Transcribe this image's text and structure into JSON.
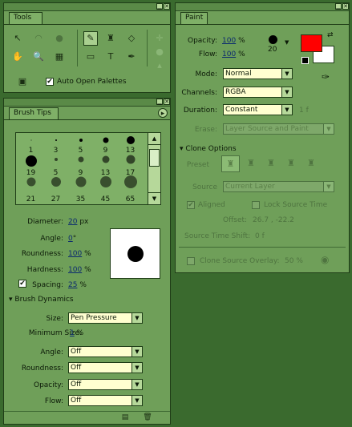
{
  "tools_panel": {
    "tab_label": "Tools",
    "auto_open_palettes_label": "Auto Open Palettes",
    "auto_open_palettes_checked": true
  },
  "brush_panel": {
    "tab_label": "Brush Tips",
    "tips_row1": [
      "1",
      "3",
      "5",
      "9",
      "13"
    ],
    "tips_row2": [
      "19",
      "5",
      "9",
      "13",
      "17"
    ],
    "tips_row3": [
      "21",
      "27",
      "35",
      "45",
      "65"
    ],
    "diameter": {
      "label": "Diameter:",
      "value": "20",
      "unit": "px"
    },
    "angle": {
      "label": "Angle:",
      "value": "0",
      "unit": "°"
    },
    "roundness": {
      "label": "Roundness:",
      "value": "100",
      "unit": "%"
    },
    "hardness": {
      "label": "Hardness:",
      "value": "100",
      "unit": "%"
    },
    "spacing": {
      "label": "Spacing:",
      "value": "25",
      "unit": "%",
      "checked": true
    },
    "dynamics": {
      "label": "Brush Dynamics",
      "size_label": "Size:",
      "size_value": "Pen Pressure",
      "min_size_label": "Minimum Size:",
      "min_size_value": "1",
      "min_size_unit": "%",
      "angle_label": "Angle:",
      "angle_value": "Off",
      "roundness_label": "Roundness:",
      "roundness_value": "Off",
      "opacity_label": "Opacity:",
      "opacity_value": "Off",
      "flow_label": "Flow:",
      "flow_value": "Off"
    }
  },
  "paint_panel": {
    "tab_label": "Paint",
    "opacity": {
      "label": "Opacity:",
      "value": "100",
      "unit": "%"
    },
    "flow": {
      "label": "Flow:",
      "value": "100",
      "unit": "%"
    },
    "brush_size_preview": "20",
    "foreground_color": "#ff0000",
    "background_color": "#ffffff",
    "mode": {
      "label": "Mode:",
      "value": "Normal"
    },
    "channels": {
      "label": "Channels:",
      "value": "RGBA"
    },
    "duration": {
      "label": "Duration:",
      "value": "Constant",
      "suffix": "1 f"
    },
    "erase": {
      "label": "Erase:",
      "value": "Layer Source and Paint"
    },
    "clone_options": {
      "label": "Clone Options",
      "preset_label": "Preset",
      "source_label": "Source",
      "source_value": "Current Layer",
      "aligned_label": "Aligned",
      "aligned_checked": true,
      "lock_source_time_label": "Lock Source Time",
      "lock_source_time_checked": false,
      "offset_label": "Offset:",
      "offset_value": "26.7 , -22.2",
      "source_time_shift_label": "Source Time Shift:",
      "source_time_shift_value": "0 f",
      "clone_source_overlay_label": "Clone Source Overlay:",
      "clone_source_overlay_value": "50 %",
      "clone_source_overlay_checked": false
    }
  }
}
